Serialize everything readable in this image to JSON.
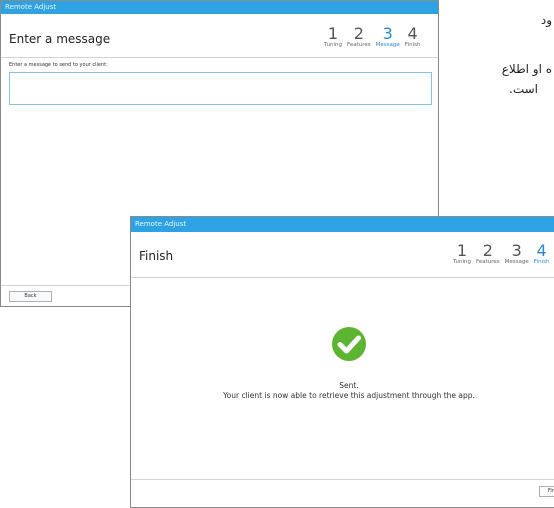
{
  "background_text": {
    "line1": "ود",
    "line2": "ه او اطلاع",
    "line3": "است."
  },
  "window_message": {
    "app_title": "Remote Adjust",
    "page_title": "Enter a message",
    "steps": [
      {
        "number": "1",
        "label": "Tuning"
      },
      {
        "number": "2",
        "label": "Features"
      },
      {
        "number": "3",
        "label": "Message"
      },
      {
        "number": "4",
        "label": "Finish"
      }
    ],
    "active_step": 3,
    "field_label": "Enter a message to send to your client:",
    "message_value": "",
    "back_label": "Back"
  },
  "window_finish": {
    "app_title": "Remote Adjust",
    "page_title": "Finish",
    "steps": [
      {
        "number": "1",
        "label": "Tuning"
      },
      {
        "number": "2",
        "label": "Features"
      },
      {
        "number": "3",
        "label": "Message"
      },
      {
        "number": "4",
        "label": "Finish"
      }
    ],
    "active_step": 4,
    "status_icon": "check-circle-icon",
    "status_title": "Sent.",
    "status_message": "Your client is now able to retrieve this adjustment through the app.",
    "finish_label": "Finish"
  },
  "colors": {
    "titlebar": "#2ea3e3",
    "accent": "#2a8ad4",
    "success": "#5cb531"
  }
}
